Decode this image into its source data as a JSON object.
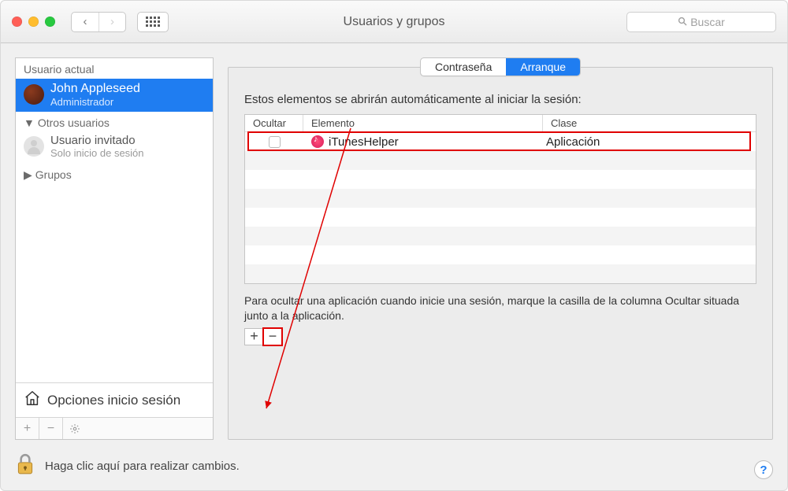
{
  "window_title": "Usuarios y grupos",
  "search_placeholder": "Buscar",
  "sidebar": {
    "current_label": "Usuario actual",
    "user_name": "John Appleseed",
    "user_role": "Administrador",
    "others_label": "Otros usuarios",
    "guest_name": "Usuario invitado",
    "guest_sub": "Solo inicio de sesión",
    "groups_label": "Grupos",
    "login_options": "Opciones inicio sesión"
  },
  "tabs": {
    "password": "Contraseña",
    "startup": "Arranque"
  },
  "main": {
    "description": "Estos elementos se abrirán automáticamente al iniciar la sesión:",
    "columns": {
      "hide": "Ocultar",
      "element": "Elemento",
      "class": "Clase"
    },
    "rows": [
      {
        "hidden": false,
        "name": "iTunesHelper",
        "class": "Aplicación"
      }
    ],
    "hint": "Para ocultar una aplicación cuando inicie una sesión, marque la casilla de la columna Ocultar situada junto a la aplicación."
  },
  "footer": {
    "lock_text": "Haga clic aquí para realizar cambios."
  }
}
